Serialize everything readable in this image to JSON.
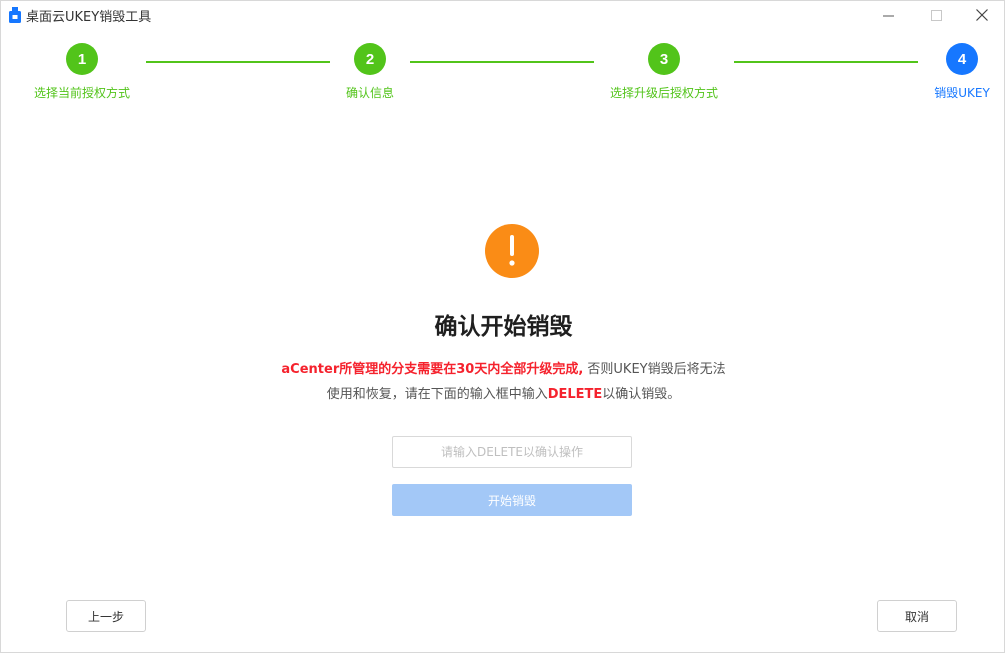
{
  "window": {
    "title": "桌面云UKEY销毁工具"
  },
  "steps": [
    {
      "number": "1",
      "label": "选择当前授权方式",
      "status": "done"
    },
    {
      "number": "2",
      "label": "确认信息",
      "status": "done"
    },
    {
      "number": "3",
      "label": "选择升级后授权方式",
      "status": "done"
    },
    {
      "number": "4",
      "label": "销毁UKEY",
      "status": "active"
    }
  ],
  "content": {
    "icon": "exclamation-icon",
    "title": "确认开始销毁",
    "desc_line1_highlight": "aCenter所管理的分支需要在30天内全部升级完成,",
    "desc_line1_rest": " 否则UKEY销毁后将无法",
    "desc_line2_pre": "使用和恢复，请在下面的输入框中输入",
    "desc_line2_keyword": "DELETE",
    "desc_line2_post": "以确认销毁。",
    "input_value": "",
    "input_placeholder": "请输入DELETE以确认操作",
    "start_button": "开始销毁"
  },
  "footer": {
    "prev_button": "上一步",
    "cancel_button": "取消"
  },
  "colors": {
    "done": "#52c41a",
    "active": "#1677ff",
    "warning": "#fa8c16",
    "highlight": "#f5222d",
    "disabled_primary": "#a3c8f7"
  }
}
